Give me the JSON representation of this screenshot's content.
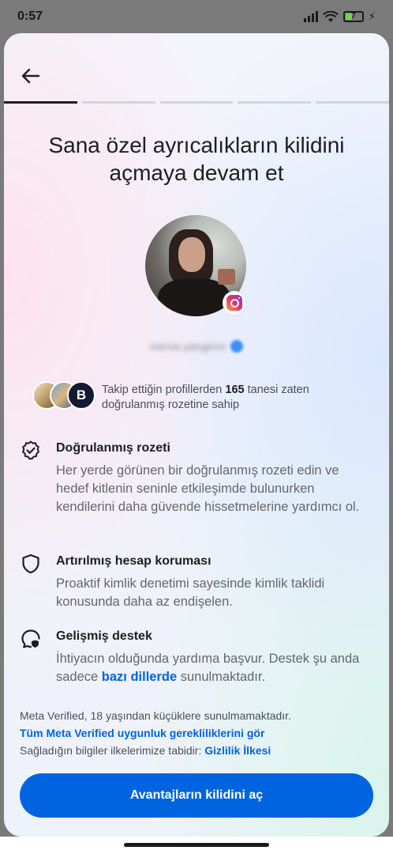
{
  "status_bar": {
    "time": "0:57",
    "battery": "7"
  },
  "title": "Sana özel ayrıcalıkların kilidini açmaya devam et",
  "profile": {
    "username": "merve.yangiron"
  },
  "progress": {
    "total_steps": 5,
    "current_step": 1
  },
  "follow_info": {
    "prefix": "Takip ettiğin profillerden ",
    "count": "165",
    "suffix": " tanesi zaten doğrulanmış rozetine sahip",
    "avatar3_letter": "B"
  },
  "features": [
    {
      "title": "Doğrulanmış rozeti",
      "description": "Her yerde görünen bir doğrulanmış rozeti edin ve hedef kitlenin seninle etkileşimde bulunurken kendilerini daha güvende hissetmelerine yardımcı ol."
    },
    {
      "title": "Artırılmış hesap koruması",
      "description": "Proaktif kimlik denetimi sayesinde kimlik taklidi konusunda daha az endişelen."
    },
    {
      "title": "Gelişmiş destek",
      "description_prefix": "İhtiyacın olduğunda yardıma başvur. Destek şu anda sadece ",
      "description_link": "bazı dillerde",
      "description_suffix": " sunulmaktadır."
    }
  ],
  "footer": {
    "line1": "Meta Verified, 18 yaşından küçüklere sunulmamaktadır.",
    "line2_link": "Tüm Meta Verified uygunluk gerekliliklerini gör",
    "line3_prefix": "Sağladığın bilgiler ilkelerimize tabidir: ",
    "line3_link": "Gizlilik İlkesi"
  },
  "cta_label": "Avantajların kilidini aç",
  "colors": {
    "accent": "#0064e0",
    "verified": "#3b8ff6"
  },
  "icons": [
    "back-arrow-icon",
    "verified-badge-icon",
    "shield-icon",
    "support-icon",
    "instagram-icon"
  ]
}
